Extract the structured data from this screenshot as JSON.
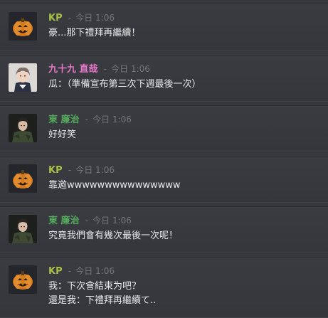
{
  "messages": [
    {
      "author": "KP",
      "author_color": "#a6c142",
      "separator": "-",
      "timestamp": "今日 1:06",
      "avatar": "pumpkin-avatar",
      "lines": [
        "豪...那下禮拜再繼續！"
      ]
    },
    {
      "author": "九十九 直哉",
      "author_color": "#e477c7",
      "separator": "-",
      "timestamp": "今日 1:06",
      "avatar": "gray-hair-boy-avatar",
      "lines": [
        "瓜：（準備宣布第三次下週最後一次）"
      ]
    },
    {
      "author": "東 廉治",
      "author_color": "#55a95c",
      "separator": "-",
      "timestamp": "今日 1:06",
      "avatar": "soldier-avatar",
      "lines": [
        "好好笑"
      ]
    },
    {
      "author": "KP",
      "author_color": "#a6c142",
      "separator": "-",
      "timestamp": "今日 1:06",
      "avatar": "pumpkin-avatar",
      "lines": [
        "靠邀wwwwwwwwwwwwwww"
      ]
    },
    {
      "author": "東 廉治",
      "author_color": "#55a95c",
      "separator": "-",
      "timestamp": "今日 1:06",
      "avatar": "soldier-avatar",
      "lines": [
        "究竟我們會有幾次最後一次呢！"
      ]
    },
    {
      "author": "KP",
      "author_color": "#a6c142",
      "separator": "-",
      "timestamp": "今日 1:06",
      "avatar": "pumpkin-avatar",
      "lines": [
        "我：下次會結束为吧？",
        "還是我：下禮拜再繼續て.."
      ]
    }
  ]
}
